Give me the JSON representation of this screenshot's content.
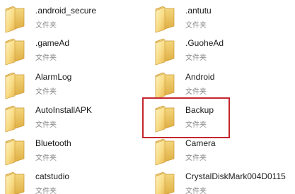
{
  "folders": [
    {
      "name": ".android_secure",
      "type": "文件夹"
    },
    {
      "name": ".antutu",
      "type": "文件夹"
    },
    {
      "name": ".gameAd",
      "type": "文件夹"
    },
    {
      "name": ".GuoheAd",
      "type": "文件夹"
    },
    {
      "name": "AlarmLog",
      "type": "文件夹"
    },
    {
      "name": "Android",
      "type": "文件夹"
    },
    {
      "name": "AutoInstallAPK",
      "type": "文件夹"
    },
    {
      "name": "Backup",
      "type": "文件夹"
    },
    {
      "name": "Bluetooth",
      "type": "文件夹"
    },
    {
      "name": "Camera",
      "type": "文件夹"
    },
    {
      "name": "catstudio",
      "type": "文件夹"
    },
    {
      "name": "CrystalDiskMark004D0115",
      "type": "文件夹"
    }
  ],
  "highlighted_folder": "Backup",
  "highlight_color": "#c4262e",
  "folder_icon": "folder-icon"
}
